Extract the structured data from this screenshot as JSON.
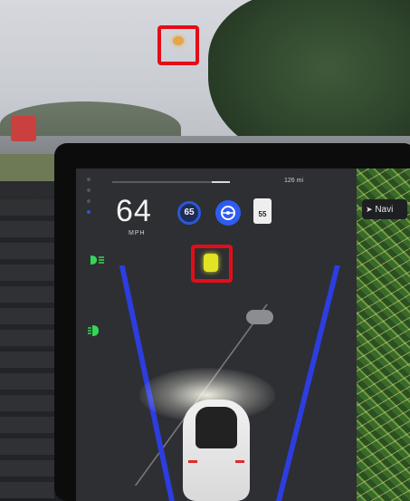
{
  "dashboard": {
    "speed": "64",
    "speed_unit": "MPH",
    "cruise_speed": "65",
    "speed_limit": "55",
    "status_text": "126 mi",
    "map_nav_label": "Navi"
  },
  "colors": {
    "highlight": "#e40d17",
    "lane": "#2d3de0",
    "lead_vehicle": "#e3e325",
    "indicator_green": "#35d65a",
    "autosteer_blue": "#2f5cf0"
  },
  "icons": [
    "headlight-icon",
    "fog-light-icon",
    "steering-wheel-icon",
    "navigation-arrow-icon"
  ]
}
